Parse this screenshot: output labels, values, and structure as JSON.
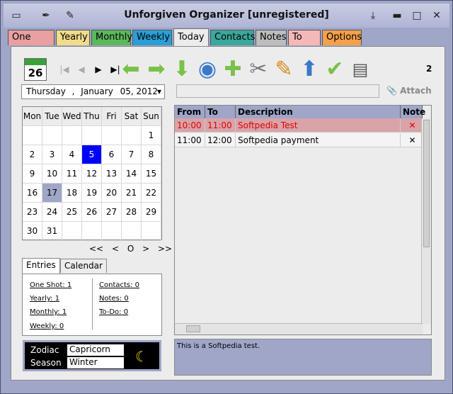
{
  "window": {
    "title": "Unforgiven Organizer [unregistered]"
  },
  "title_icons_left": [
    "organizer-icon",
    "pin-icon",
    "pencil-icon"
  ],
  "title_icons_right": [
    "pin-down-icon",
    "minimize-icon",
    "maximize-icon",
    "close-icon"
  ],
  "tabs": [
    {
      "label": "One Shot",
      "color": "#e8a0a0"
    },
    {
      "label": "Yearly",
      "color": "#f0dc8a"
    },
    {
      "label": "Monthly",
      "color": "#5cb85c"
    },
    {
      "label": "Weekly",
      "color": "#2a9fd6"
    },
    {
      "label": "Today",
      "color": "#ececec"
    },
    {
      "label": "Contacts",
      "color": "#3aa89a"
    },
    {
      "label": "Notes",
      "color": "#bdbdbd"
    },
    {
      "label": "To Do",
      "color": "#f5b8b8"
    },
    {
      "label": "Options",
      "color": "#f5a04a"
    }
  ],
  "active_tab": "Today",
  "toolbar": {
    "calendar_day": "26",
    "icons": [
      "first-icon",
      "prev-icon",
      "next-icon",
      "last-icon",
      "back-arrow-icon",
      "forward-arrow-icon",
      "down-arrow-icon",
      "globe-icon",
      "add-icon",
      "cut-icon",
      "edit-icon",
      "upload-icon",
      "check-icon",
      "print-icon"
    ],
    "page_number": "2"
  },
  "date": {
    "weekday": "Thursday",
    "month": "January",
    "day": "05, 2012"
  },
  "attach": {
    "label": "Attach"
  },
  "calendar": {
    "days": [
      "Mon",
      "Tue",
      "Wed",
      "Thu",
      "Fri",
      "Sat",
      "Sun"
    ],
    "weeks": [
      [
        "",
        "",
        "",
        "",
        "",
        "",
        "1"
      ],
      [
        "2",
        "3",
        "4",
        "5",
        "6",
        "7",
        "8"
      ],
      [
        "9",
        "10",
        "11",
        "12",
        "13",
        "14",
        "15"
      ],
      [
        "16",
        "17",
        "18",
        "19",
        "20",
        "21",
        "22"
      ],
      [
        "23",
        "24",
        "25",
        "26",
        "27",
        "28",
        "29"
      ],
      [
        "30",
        "31",
        "",
        "",
        "",
        "",
        ""
      ]
    ],
    "today": "5",
    "selected": "17",
    "nav": [
      "<<",
      "<",
      "O",
      ">",
      ">>"
    ]
  },
  "subtabs": [
    "Entries",
    "Calendar"
  ],
  "entries": {
    "one_shot": "One Shot: 1",
    "yearly": "Yearly: 1",
    "monthly": "Monthly: 1",
    "weekly": "Weekly: 0",
    "contacts": "Contacts: 0",
    "notes": "Notes: 0",
    "todo": "To-Do: 0"
  },
  "zodiac": {
    "zodiac_label": "Zodiac",
    "zodiac_value": "Capricorn",
    "season_label": "Season",
    "season_value": "Winter"
  },
  "table": {
    "headers": [
      "From",
      "To",
      "Description",
      "Note"
    ],
    "rows": [
      {
        "from": "10:00",
        "to": "11:00",
        "description": "Softpedia Test",
        "note": "✕",
        "highlight": true
      },
      {
        "from": "11:00",
        "to": "12:00",
        "description": "Softpedia payment",
        "note": "✕",
        "highlight": false
      }
    ]
  },
  "note_text": "This is a Softpedia test."
}
